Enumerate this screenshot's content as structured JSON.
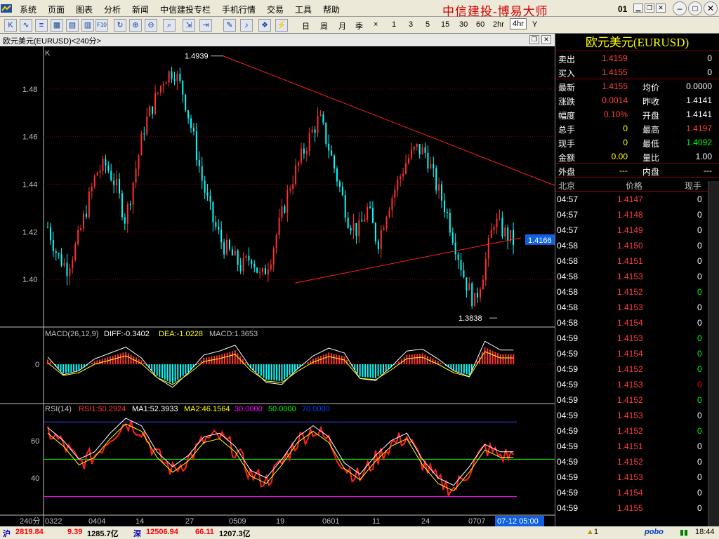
{
  "menubar": {
    "items": [
      "系统",
      "页面",
      "图表",
      "分析",
      "新闻",
      "中信建投专栏",
      "手机行情",
      "交易",
      "工具",
      "帮助"
    ],
    "brand": "中信建投-博易大师",
    "page": "01"
  },
  "toolbar": {
    "periods": [
      "日",
      "周",
      "月",
      "季",
      "×",
      "1",
      "3",
      "5",
      "15",
      "30",
      "60",
      "2hr",
      "4hr",
      "Y"
    ],
    "selected": "4hr"
  },
  "chart": {
    "title": "欧元美元(EURUSD)<240分>",
    "kline_label": "K",
    "annotations": {
      "high": "1.4939",
      "low": "1.3838",
      "current": "1.4166"
    },
    "price_ticks": [
      "1.48",
      "1.46",
      "1.44",
      "1.42",
      "1.40"
    ],
    "macd": {
      "label": "MACD(26,12,9)",
      "diff": "DIFF:-0.3402",
      "dea": "DEA:-1.0228",
      "macd": "MACD:1.3653",
      "zero": "0"
    },
    "rsi": {
      "label": "RSI(14)",
      "rsi1": "RSI1:50.2924",
      "ma1": "MA1:52.3933",
      "ma2": "MA2:46.1564",
      "l30": "30.0000",
      "l50": "50.0000",
      "l70": "70.0000",
      "ticks": [
        "60",
        "40"
      ]
    },
    "xticks": [
      "0322",
      "0404",
      "14",
      "27",
      "0509",
      "19",
      "0601",
      "11",
      "24",
      "0707"
    ],
    "period": "240分",
    "cursor": "07-12 05:00"
  },
  "chart_data": {
    "type": "candlestick",
    "title": "欧元美元(EURUSD)<240分>",
    "ylim": [
      1.38,
      1.495
    ],
    "high": 1.4939,
    "low": 1.3838,
    "last": 1.4166,
    "x": [
      "0322",
      "0404",
      "14",
      "27",
      "0509",
      "19",
      "0601",
      "11",
      "24",
      "0707"
    ],
    "closes": [
      1.422,
      1.41,
      1.405,
      1.415,
      1.43,
      1.445,
      1.448,
      1.44,
      1.425,
      1.445,
      1.465,
      1.475,
      1.485,
      1.488,
      1.478,
      1.46,
      1.44,
      1.425,
      1.415,
      1.41,
      1.405,
      1.41,
      1.4,
      1.41,
      1.425,
      1.44,
      1.45,
      1.46,
      1.468,
      1.455,
      1.44,
      1.425,
      1.42,
      1.43,
      1.415,
      1.43,
      1.44,
      1.45,
      1.455,
      1.453,
      1.44,
      1.43,
      1.415,
      1.4,
      1.39,
      1.405,
      1.425,
      1.42,
      1.416
    ],
    "macd_hist": [
      0.6,
      -1.2,
      -0.8,
      0.4,
      1.0,
      1.6,
      0.5,
      -1.5,
      -2.5,
      -1.0,
      0.8,
      1.2,
      1.8,
      -0.5,
      -2.0,
      -2.2,
      -0.6,
      0.7,
      1.5,
      1.0,
      -1.6,
      -1.8,
      -0.4,
      1.2,
      1.4,
      0.4,
      -0.8,
      -1.4,
      2.2,
      1.3
    ],
    "rsi1": [
      65,
      58,
      48,
      52,
      62,
      70,
      66,
      52,
      44,
      50,
      60,
      62,
      55,
      42,
      38,
      48,
      60,
      66,
      60,
      46,
      40,
      50,
      58,
      62,
      48,
      38,
      34,
      44,
      56,
      52
    ],
    "rsi_levels": [
      30,
      50,
      70
    ]
  },
  "quote": {
    "title": "欧元美元(EURUSD)",
    "sell_label": "卖出",
    "sell": "1.4159",
    "sell_vol": "0",
    "buy_label": "买入",
    "buy": "1.4155",
    "buy_vol": "0",
    "rows": [
      [
        "最新",
        "1.4155",
        "均价",
        "0.0000"
      ],
      [
        "涨跌",
        "0.0014",
        "昨收",
        "1.4141"
      ],
      [
        "幅度",
        "0.10%",
        "开盘",
        "1.4141"
      ],
      [
        "总手",
        "0",
        "最高",
        "1.4197"
      ],
      [
        "现手",
        "0",
        "最低",
        "1.4092"
      ],
      [
        "金额",
        "0.00",
        "量比",
        "1.00"
      ],
      [
        "外盘",
        "---",
        "内盘",
        "---"
      ]
    ]
  },
  "ticks": {
    "headers": [
      "北京",
      "价格",
      "现手"
    ],
    "rows": [
      [
        "04:57",
        "1.4147",
        "0"
      ],
      [
        "04:57",
        "1.4148",
        "0"
      ],
      [
        "04:57",
        "1.4149",
        "0"
      ],
      [
        "04:58",
        "1.4150",
        "0"
      ],
      [
        "04:58",
        "1.4151",
        "0"
      ],
      [
        "04:58",
        "1.4153",
        "0"
      ],
      [
        "04:58",
        "1.4152",
        "0"
      ],
      [
        "04:58",
        "1.4153",
        "0"
      ],
      [
        "04:58",
        "1.4154",
        "0"
      ],
      [
        "04:59",
        "1.4153",
        "0"
      ],
      [
        "04:59",
        "1.4154",
        "0"
      ],
      [
        "04:59",
        "1.4152",
        "0"
      ],
      [
        "04:59",
        "1.4153",
        "0"
      ],
      [
        "04:59",
        "1.4152",
        "0"
      ],
      [
        "04:59",
        "1.4153",
        "0"
      ],
      [
        "04:59",
        "1.4152",
        "0"
      ],
      [
        "04:59",
        "1.4151",
        "0"
      ],
      [
        "04:59",
        "1.4152",
        "0"
      ],
      [
        "04:59",
        "1.4153",
        "0"
      ],
      [
        "04:59",
        "1.4154",
        "0"
      ],
      [
        "04:59",
        "1.4155",
        "0"
      ]
    ],
    "colors": [
      "#ffffff",
      "#ffffff",
      "#ffffff",
      "#ffffff",
      "#ffffff",
      "#ffffff",
      "#00ff00",
      "#ffffff",
      "#ffffff",
      "#00ff00",
      "#00ff00",
      "#00ff00",
      "#ff0000",
      "#00ff00",
      "#ffffff",
      "#00ff00",
      "#ffffff",
      "#ffffff",
      "#ffffff",
      "#ffffff",
      "#ffffff"
    ]
  },
  "statusbar": {
    "sh_label": "沪",
    "sh_index": "2819.84",
    "sh_chg": "9.39",
    "sh_amt": "1285.7亿",
    "sz_label": "深",
    "sz_index": "12506.94",
    "sz_chg": "66.11",
    "sz_amt": "1207.3亿",
    "alert": "1",
    "pobo": "pobo",
    "time": "18:44"
  },
  "colors": {
    "up": "#ff3030",
    "down": "#00ffff",
    "grid": "#800000"
  }
}
